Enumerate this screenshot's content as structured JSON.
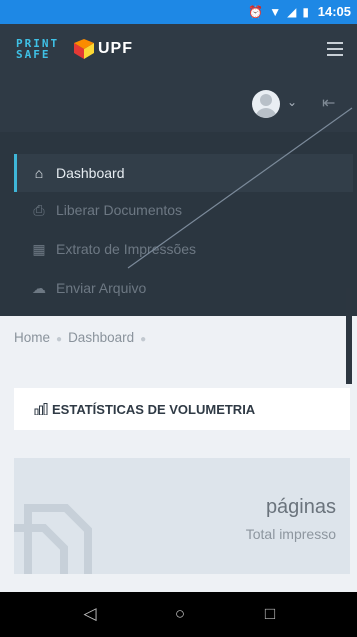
{
  "statusbar": {
    "time": "14:05",
    "icons": [
      "alarm-icon",
      "wifi-icon",
      "signal-icon",
      "battery-icon"
    ]
  },
  "brand": {
    "print_safe": "PRINT SAFE",
    "upf": "UPF"
  },
  "menu": {
    "items": [
      {
        "label": "Dashboard",
        "icon": "home-icon",
        "active": true
      },
      {
        "label": "Liberar Documentos",
        "icon": "printer-icon",
        "active": false
      },
      {
        "label": "Extrato de Impressões",
        "icon": "grid-icon",
        "active": false
      },
      {
        "label": "Enviar Arquivo",
        "icon": "cloud-upload-icon",
        "active": false
      }
    ]
  },
  "breadcrumb": {
    "home": "Home",
    "current": "Dashboard"
  },
  "panel": {
    "title": "ESTATÍSTICAS DE VOLUMETRIA",
    "icon": "bar-chart-icon"
  },
  "stat": {
    "value": "páginas",
    "label": "Total impresso"
  },
  "colors": {
    "header": "#2f3a45",
    "accent": "#3fb6d8",
    "statusbar": "#1e88e5"
  }
}
